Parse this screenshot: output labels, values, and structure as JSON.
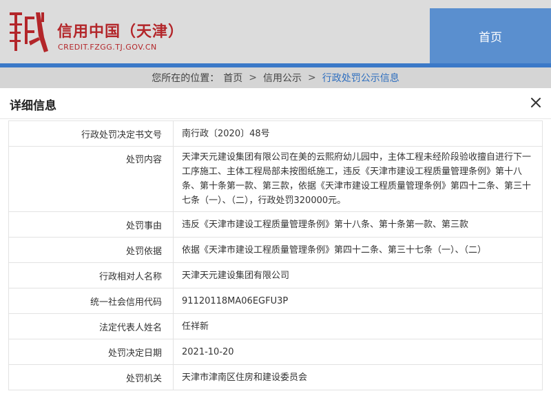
{
  "header": {
    "brand_title": "信用中国（天津）",
    "brand_url": "CREDIT.FZGG.TJ.GOV.CN",
    "nav_home": "首页",
    "colors": {
      "brand_red": "#b3262a",
      "nav_blue": "#5a8fcf",
      "bar_blue": "#3b79c8"
    }
  },
  "breadcrumb": {
    "prefix": "您所在的位置：",
    "items": [
      "首页",
      "信用公示",
      "行政处罚公示信息"
    ],
    "separator": ">"
  },
  "panel": {
    "title": "详细信息",
    "close_icon": "close-icon",
    "rows": [
      {
        "label": "行政处罚决定书文号",
        "value": "南行政〔2020〕48号"
      },
      {
        "label": "处罚内容",
        "value": "天津天元建设集团有限公司在美的云熙府幼儿园中，主体工程未经阶段验收擅自进行下一工序施工、主体工程局部未按图纸施工，违反《天津市建设工程质量管理条例》第十八条、第十条第一款、第三款，依据《天津市建设工程质量管理条例》第四十二条、第三十七条（一）、（二），行政处罚320000元。"
      },
      {
        "label": "处罚事由",
        "value": "违反《天津市建设工程质量管理条例》第十八条、第十条第一款、第三款"
      },
      {
        "label": "处罚依据",
        "value": "依据《天津市建设工程质量管理条例》第四十二条、第三十七条（一）、（二）"
      },
      {
        "label": "行政相对人名称",
        "value": "天津天元建设集团有限公司"
      },
      {
        "label": "统一社会信用代码",
        "value": "91120118MA06EGFU3P"
      },
      {
        "label": "法定代表人姓名",
        "value": "任祥新"
      },
      {
        "label": "处罚决定日期",
        "value": "2021-10-20"
      },
      {
        "label": "处罚机关",
        "value": "天津市津南区住房和建设委员会"
      }
    ]
  }
}
